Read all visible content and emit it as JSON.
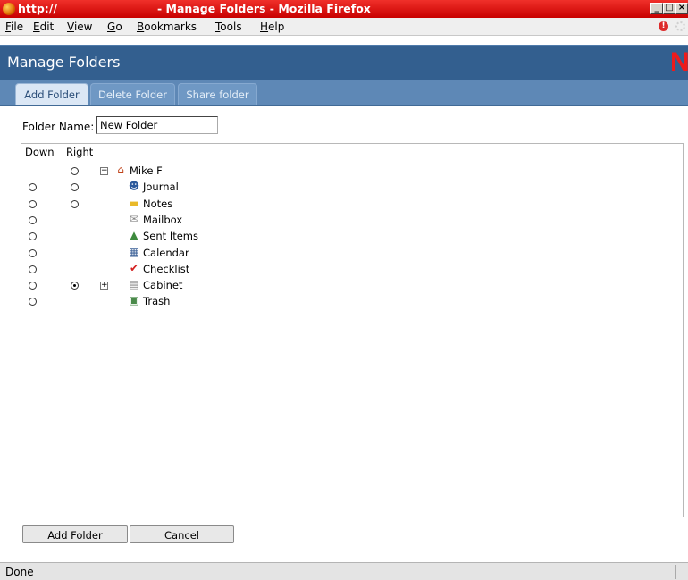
{
  "window": {
    "url_fragment": "http://",
    "title": "- Manage Folders - Mozilla Firefox",
    "controls": [
      "_",
      "□",
      "×"
    ]
  },
  "menubar": {
    "items": [
      {
        "first": "F",
        "rest": "ile"
      },
      {
        "first": "E",
        "rest": "dit"
      },
      {
        "first": "V",
        "rest": "iew"
      },
      {
        "first": "G",
        "rest": "o"
      },
      {
        "first": "B",
        "rest": "ookmarks"
      },
      {
        "first": "T",
        "rest": "ools"
      },
      {
        "first": "H",
        "rest": "elp"
      }
    ]
  },
  "header": {
    "title": "Manage Folders",
    "logo": "N"
  },
  "tabs": [
    {
      "label": "Add Folder",
      "active": true
    },
    {
      "label": "Delete Folder",
      "active": false
    },
    {
      "label": "Share folder",
      "active": false
    }
  ],
  "form": {
    "folder_name_label": "Folder Name:",
    "folder_name_value": "New Folder"
  },
  "tree": {
    "col_down": "Down",
    "col_right": "Right",
    "items": [
      {
        "label": "Mike F",
        "icon": "home-icon",
        "down_radio": false,
        "right_radio": true,
        "right_checked": false,
        "expander": "minus"
      },
      {
        "label": "Journal",
        "icon": "journal-icon",
        "down_radio": true,
        "right_radio": true,
        "right_checked": false,
        "expander": ""
      },
      {
        "label": "Notes",
        "icon": "folder-icon",
        "down_radio": true,
        "right_radio": true,
        "right_checked": false,
        "expander": ""
      },
      {
        "label": "Mailbox",
        "icon": "mailbox-icon",
        "down_radio": true,
        "right_radio": false,
        "right_checked": false,
        "expander": ""
      },
      {
        "label": "Sent Items",
        "icon": "sent-items-icon",
        "down_radio": true,
        "right_radio": false,
        "right_checked": false,
        "expander": ""
      },
      {
        "label": "Calendar",
        "icon": "calendar-icon",
        "down_radio": true,
        "right_radio": false,
        "right_checked": false,
        "expander": ""
      },
      {
        "label": "Checklist",
        "icon": "checklist-icon",
        "down_radio": true,
        "right_radio": false,
        "right_checked": false,
        "expander": ""
      },
      {
        "label": "Cabinet",
        "icon": "cabinet-icon",
        "down_radio": true,
        "right_radio": true,
        "right_checked": true,
        "expander": "plus"
      },
      {
        "label": "Trash",
        "icon": "trash-icon",
        "down_radio": true,
        "right_radio": false,
        "right_checked": false,
        "expander": ""
      }
    ]
  },
  "buttons": {
    "add_folder": "Add Folder",
    "cancel": "Cancel"
  },
  "status": {
    "text": "Done"
  },
  "colors": {
    "titlebar": "#e01010",
    "header": "#335f8f",
    "tabbar": "#5e88b6",
    "logo": "#ee1b1b"
  }
}
